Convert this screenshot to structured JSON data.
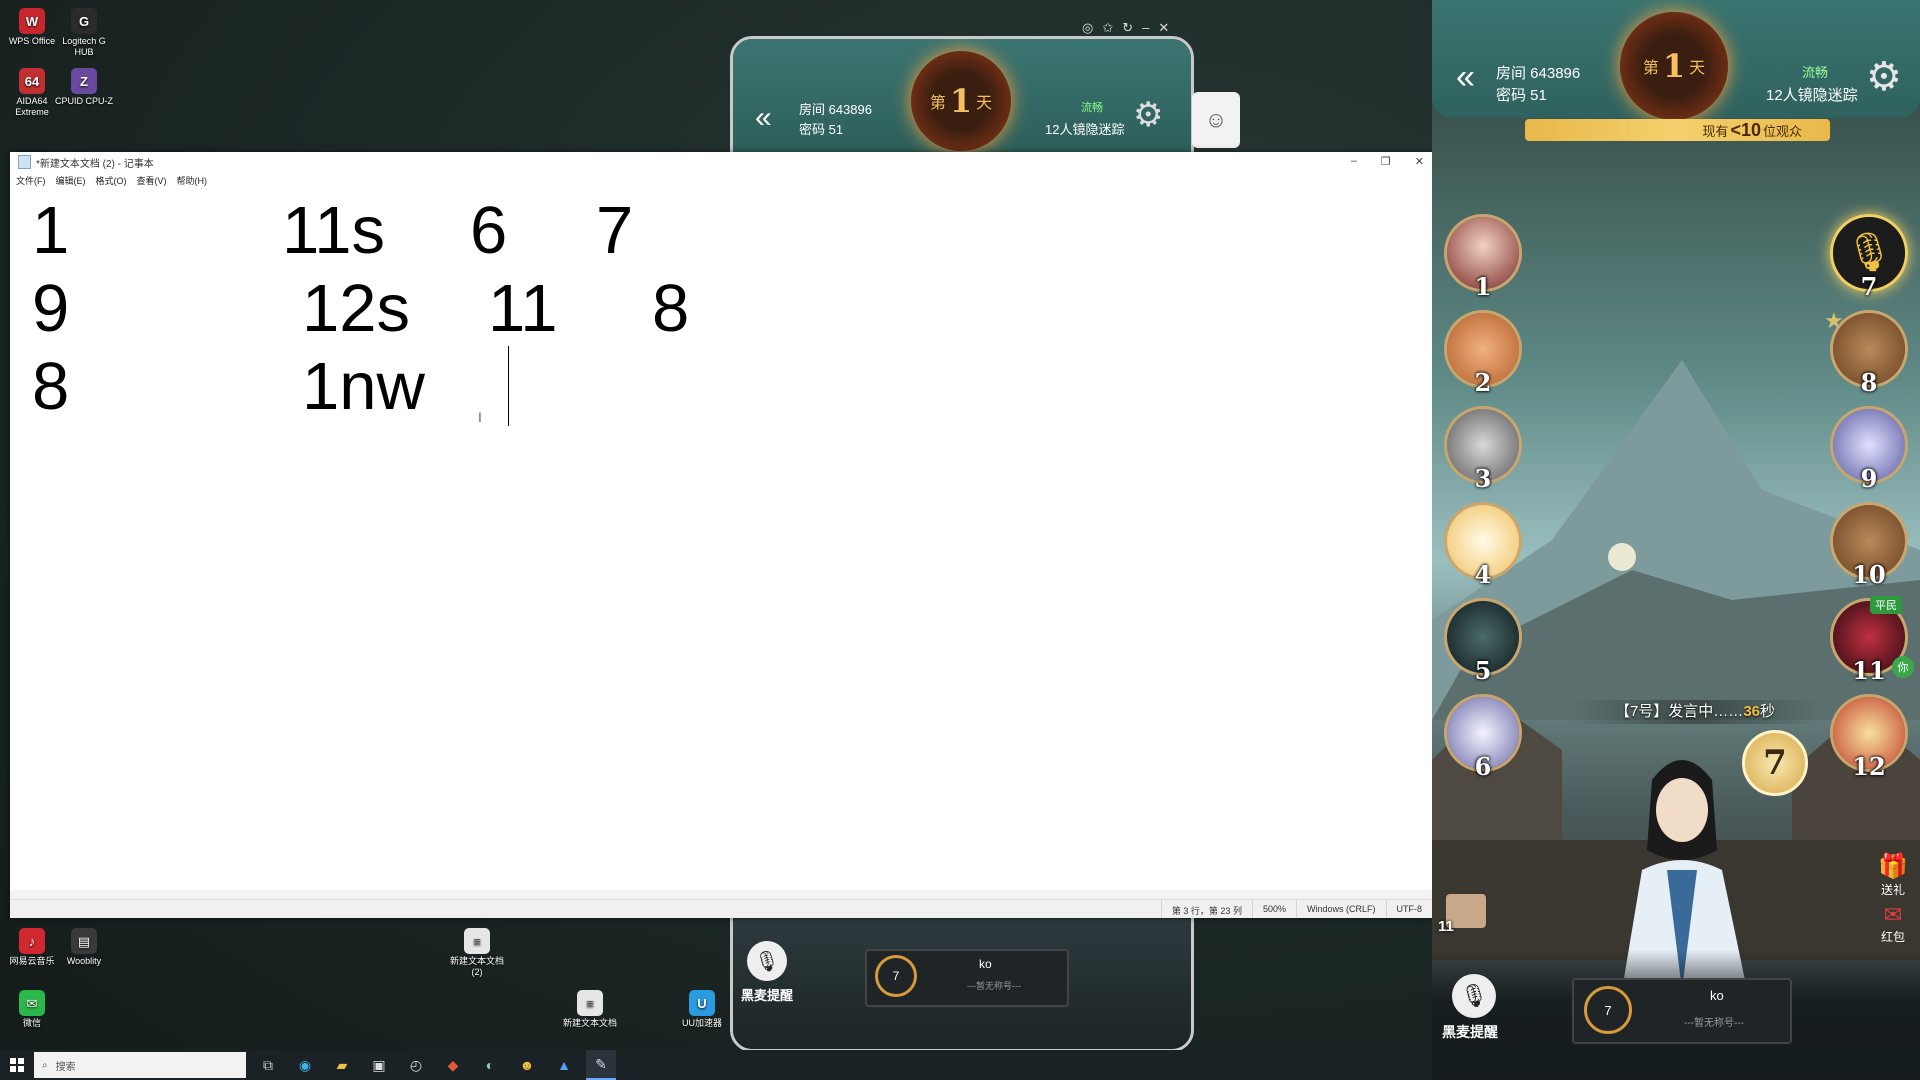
{
  "desktop": {
    "icons": [
      {
        "label": "WPS Office",
        "color": "#c8262e",
        "glyph": "W"
      },
      {
        "label": "Logitech G HUB",
        "color": "#2b2b2b",
        "glyph": "G"
      },
      {
        "label": "AIDA64 Extreme",
        "color": "#c03030",
        "glyph": "64"
      },
      {
        "label": "CPUID CPU-Z",
        "color": "#6a4aa0",
        "glyph": "Z"
      },
      {
        "label": "网易云音乐",
        "color": "#d0282e",
        "glyph": "♪"
      },
      {
        "label": "Wooblity",
        "color": "#3a3a3a",
        "glyph": "▤"
      },
      {
        "label": "新建文本文档 (2)",
        "color": "#e6e6e6",
        "glyph": "≡"
      },
      {
        "label": "微信",
        "color": "#2cb74a",
        "glyph": "✉"
      },
      {
        "label": "新建文本文档",
        "color": "#e6e6e6",
        "glyph": "≡"
      },
      {
        "label": "UU加速器",
        "color": "#2a9be0",
        "glyph": "U"
      }
    ]
  },
  "mini_phone": {
    "room": "房间 643896",
    "password": "密码 51",
    "signal": "流畅",
    "mode": "12人镜隐迷踪",
    "day_prefix": "第",
    "day_number": "1",
    "day_suffix": "天",
    "mic_label": "黑麦提醒",
    "player_name": "ko",
    "player_sub": "---暂无称号---",
    "timer": "7"
  },
  "notepad": {
    "title": "*新建文本文档 (2) - 记事本",
    "menu": [
      "文件(F)",
      "编辑(E)",
      "格式(O)",
      "查看(V)",
      "帮助(H)"
    ],
    "lines": [
      [
        "1",
        "11s",
        "6",
        "7"
      ],
      [
        "9",
        "12s",
        "11",
        "8"
      ],
      [
        "8",
        "1nw"
      ]
    ],
    "status": {
      "position": "第 3 行，第 23 列",
      "zoom": "500%",
      "line_ending": "Windows (CRLF)",
      "encoding": "UTF-8"
    }
  },
  "taskbar": {
    "search_placeholder": "搜索",
    "apps": [
      "task-view-icon",
      "edge-icon",
      "file-explorer-icon",
      "store-icon",
      "clock-icon",
      "game-icon",
      "steam-icon",
      "app-icon",
      "photo-icon",
      "notepad-icon"
    ]
  },
  "game": {
    "room": "房间 643896",
    "password": "密码 51",
    "signal": "流畅",
    "mode": "12人镜隐迷踪",
    "day_prefix": "第",
    "day_number": "1",
    "day_suffix": "天",
    "observers_prefix": "现有",
    "observers_count": "<10",
    "observers_suffix": "位观众",
    "left_seats": [
      "1",
      "2",
      "3",
      "4",
      "5",
      "6"
    ],
    "right_seats": [
      "7",
      "8",
      "9",
      "10",
      "11",
      "12"
    ],
    "role_badge": "平民",
    "you_badge": "你",
    "speech_prefix": "【7号】发言中……",
    "speech_seconds": "36",
    "speech_unit": "秒",
    "current_speaker": "7",
    "gift_label": "送礼",
    "redpack_label": "红包",
    "counter_small": "11",
    "mic_label": "黑麦提醒",
    "player_name": "ko",
    "player_sub": "---暂无称号---",
    "timer": "7",
    "colors": {
      "accent": "#f0c040",
      "seat_border": "#caa56c",
      "topbar": "#3a7470"
    }
  }
}
